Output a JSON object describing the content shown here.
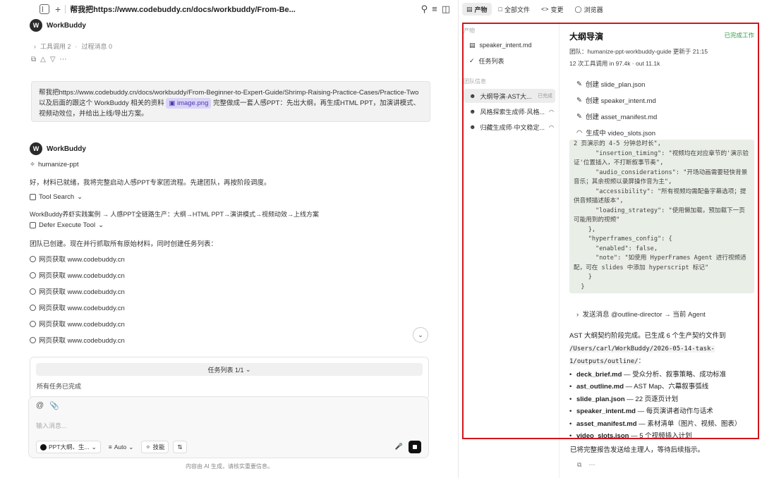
{
  "topbar": {
    "title": "帮我把https://www.codebuddy.cn/docs/workbuddy/From-Be...",
    "icons": [
      "sidebar-icon",
      "plus-icon",
      "search-icon",
      "menu-icon",
      "panel-icon"
    ]
  },
  "agent_name": "WorkBuddy",
  "meta": {
    "tool_calls": "工具调用 2",
    "process_msgs": "过程消息 0"
  },
  "user_message": {
    "text_before": "帮我把https://www.codebuddy.cn/docs/workbuddy/From-Beginner-to-Expert-Guide/Shrimp-Raising-Practice-Cases/Practice-Two 以及后面的跟这个 WorkBuddy 相关的资料 ",
    "chip": "image.png",
    "text_after": " 完整做成一套人感PPT：先出大纲，再生成HTML PPT，加演讲模式、视频动效位，并给出上线/导出方案。"
  },
  "reply": {
    "skill": "humanize-ppt",
    "intro": "好，材料已就绪，我将完整启动人感PPT专家团流程。先建团队，再按阶段调度。",
    "tool_search": "Tool Search",
    "workflow": "WorkBuddy养虾实践案例 → 人感PPT全链路生产：大纲→HTML PPT→演讲模式→视频动效→上线方案",
    "defer_tool": "Defer Execute Tool",
    "team_created": "团队已创建。现在并行抓取所有原始材料，同时创建任务列表：",
    "fetches": [
      "网页获取 www.codebuddy.cn",
      "网页获取 www.codebuddy.cn",
      "网页获取 www.codebuddy.cn",
      "网页获取 www.codebuddy.cn",
      "网页获取 www.codebuddy.cn",
      "网页获取 www.codebuddy.cn"
    ]
  },
  "task_panel": {
    "header": "任务列表 1/1",
    "body": "所有任务已完成"
  },
  "input": {
    "placeholder": "输入消息...",
    "model_label": "PPT大纲、生...",
    "mode_label": "Auto",
    "skill_label": "技能"
  },
  "footer_note": "内容由 AI 生成，请核实重要信息。",
  "right_tabs": [
    "产物",
    "全部文件",
    "变更",
    "浏览器"
  ],
  "files": {
    "artifacts_label": "产物",
    "artifacts": [
      "speaker_intent.md",
      "任务列表"
    ],
    "team_label": "团队信息",
    "team": [
      {
        "name": "大纲导演·AST大...",
        "status": "已完成"
      },
      {
        "name": "风格探索生成师·风格...",
        "status": "◠"
      },
      {
        "name": "归藏生成师·中文稳定...",
        "status": "◠"
      }
    ]
  },
  "detail": {
    "title": "大纲导演",
    "status": "已完成工作",
    "meta1": "团队：humanize-ppt-workbuddy-guide   更新于 21:15",
    "meta2": "12 次工具调用   in 97.4k · out 11.1k",
    "ops": [
      "创建 slide_plan.json",
      "创建 speaker_intent.md",
      "创建 asset_manifest.md",
      "生成中 video_slots.json"
    ],
    "code": "2 页演示的 4-5 分钟总时长\",\n      \"insertion_timing\": \"视频均在对应章节的'演示验证'位置插入，不打断叙事节奏\",\n      \"audio_considerations\": \"开场动画需要轻快背景音乐；其余视频以录屏操作音为主\",\n      \"accessibility\": \"所有视频均需配备字幕选项；提供音频描述版本\",\n      \"loading_strategy\": \"使用懒加载，预加载下一页可能用到的视频\"\n    },\n    \"hyperframes_config\": {\n      \"enabled\": false,\n      \"note\": \"如使用 HyperFrames Agent 进行视频适配，可在 slides 中添加 hyperscript 标记\"\n    }\n  }",
    "send_line": "发送消息 @outline-director → 当前 Agent",
    "summary_intro": "AST 大纲契约阶段完成。已生成 6 个生产契约文件到",
    "summary_path": "/Users/carl/WorkBuddy/2026-05-14-task-1/outputs/outline/",
    "summary_colon": "：",
    "files": [
      {
        "name": "deck_brief.md",
        "desc": " — 受众分析、叙事策略、成功标准"
      },
      {
        "name": "ast_outline.md",
        "desc": " — AST Map、六幕叙事弧线"
      },
      {
        "name": "slide_plan.json",
        "desc": " — 22 页逐页计划"
      },
      {
        "name": "speaker_intent.md",
        "desc": " — 每页演讲者动作与话术"
      },
      {
        "name": "asset_manifest.md",
        "desc": " — 素材清单（图片、视频、图表）"
      },
      {
        "name": "video_slots.json",
        "desc": " — 5 个视频插入计划"
      }
    ],
    "after": "已将完整报告发送给主理人，等待后续指示。"
  },
  "highlight_color": "#d0161c"
}
